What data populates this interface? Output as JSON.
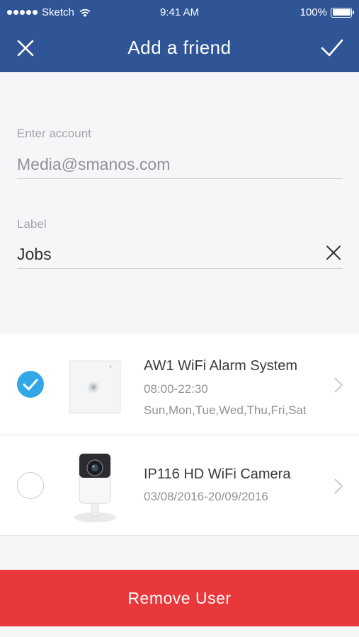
{
  "status_bar": {
    "carrier": "Sketch",
    "time": "9:41 AM",
    "battery": "100%"
  },
  "nav": {
    "title": "Add a friend",
    "close_icon": "close-icon",
    "done_icon": "checkmark-icon"
  },
  "form": {
    "account_label": "Enter account",
    "account_value": "Media@smanos.com",
    "label_label": "Label",
    "label_value": "Jobs",
    "clear_icon": "clear-icon"
  },
  "devices": [
    {
      "name": "AW1 WiFi Alarm System",
      "time_range": "08:00-22:30",
      "days": "Sun,Mon,Tue,Wed,Thu,Fri,Sat",
      "selected": true
    },
    {
      "name": "IP116 HD WiFi Camera",
      "date_range": "03/08/2016-20/09/2016",
      "selected": false
    }
  ],
  "remove_button": "Remove User",
  "colors": {
    "header": "#2f5597",
    "accent_check": "#33a6e6",
    "remove": "#e8383c"
  }
}
